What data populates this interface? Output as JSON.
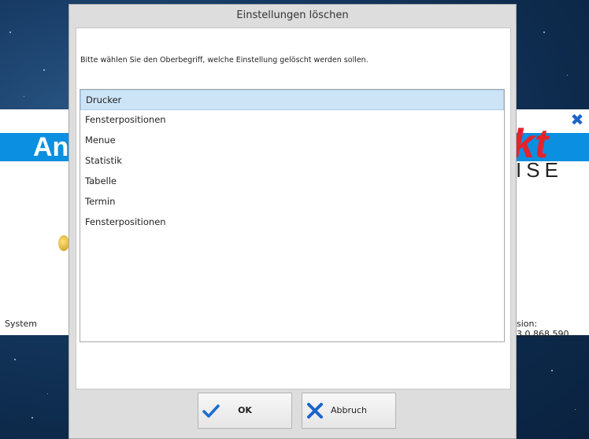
{
  "background_app": {
    "banner_left_text": "An",
    "logo_right_text": "kt",
    "subtitle_text": "ISE",
    "status_left": "System",
    "status_right": "sion: 3.0.868.590"
  },
  "dialog": {
    "title": "Einstellungen löschen",
    "instruction": "Bitte wählen Sie den Oberbegriff, welche Einstellung gelöscht werden sollen.",
    "items": [
      {
        "label": "Drucker",
        "selected": true
      },
      {
        "label": "Fensterpositionen",
        "selected": false
      },
      {
        "label": "Menue",
        "selected": false
      },
      {
        "label": "Statistik",
        "selected": false
      },
      {
        "label": "Tabelle",
        "selected": false
      },
      {
        "label": "Termin",
        "selected": false
      },
      {
        "label": "Fensterpositionen",
        "selected": false
      }
    ],
    "ok_label": "OK",
    "cancel_label": "Abbruch"
  },
  "colors": {
    "accent_blue": "#0b8fe0",
    "logo_red": "#e4232d",
    "selection": "#cde4f7",
    "ok_icon": "#1a6fd0",
    "cancel_icon": "#1a64c9"
  },
  "icons": {
    "ok": "checkmark-icon",
    "cancel": "x-icon",
    "bg_close": "close-icon"
  }
}
